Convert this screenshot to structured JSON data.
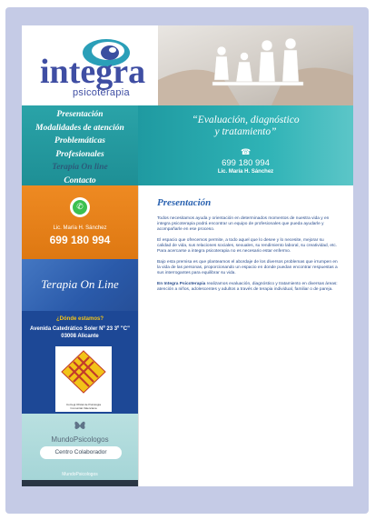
{
  "logo": {
    "name": "integra",
    "subtitle": "psicoterapia"
  },
  "nav": {
    "items": [
      {
        "label": "Presentación"
      },
      {
        "label": "Modalidades de atención"
      },
      {
        "label": "Problemáticas"
      },
      {
        "label": "Profesionales"
      },
      {
        "label": "Terapia On line"
      },
      {
        "label": "Contacto"
      }
    ],
    "active_index": 4
  },
  "banner": {
    "quote_line1": "“Evaluación, diagnóstico",
    "quote_line2": "y tratamiento”",
    "phone_icon": "phone-icon",
    "phone": "699 180 994",
    "name": "Lic. María H. Sánchez"
  },
  "sidebar": {
    "contact": {
      "icon": "whatsapp-icon",
      "name": "Lic. María H. Sánchez",
      "phone": "699 180 994"
    },
    "online": {
      "title": "Terapia On Line"
    },
    "location": {
      "question": "¿Dónde estamos?",
      "address_line1": "Avenida Catedrático Soler Nº 23 3º \"C\"",
      "address_line2": "03008 Alicante",
      "seal_caption_line1": "Col·legi Oficial de Psicologia",
      "seal_caption_line2": "Comunitat Valenciana"
    },
    "mundo": {
      "title": "MundoPsicologos",
      "button": "Centro Colaborador",
      "footer": "MundoPsicologos"
    }
  },
  "main": {
    "title": "Presentación",
    "p1": "Todos necesitamos ayuda y orientación en determinados momentos de nuestra vida y en integra psicoterapia podrá encontrar un equipo de profesionales que pueda ayudarle y acompañarle en ese proceso.",
    "p2": "El espacio que ofrecemos permite, a todo aquel que lo desee y lo necesite, mejorar su calidad de vida, sus relaciones sociales, sexuales, su rendimiento laboral, su creatividad, etc. Para acercarse a integra psicoterapia no es necesario estar enfermo.",
    "p3": "Bajo esta premisa es que planteamos el abordaje de los diversos problemas que irrumpen en la vida de las personas, proporcionando un espacio en donde puedan encontrar respuestas a sus interrogantes para equilibrar su vida.",
    "p4_bold": "En Integra Psicoterapia",
    "p4_rest": " realizamos evaluación, diagnóstico y tratamiento en diversas áreas: atención a niños, adolescentes y adultos a través de terapia individual, familiar o de pareja."
  },
  "colors": {
    "frame": "#c5cbe6",
    "teal": "#2aa3a8",
    "orange": "#ee8a22",
    "blue": "#2a5aaa",
    "navy": "#1d4896",
    "title_blue": "#2a62b0"
  }
}
